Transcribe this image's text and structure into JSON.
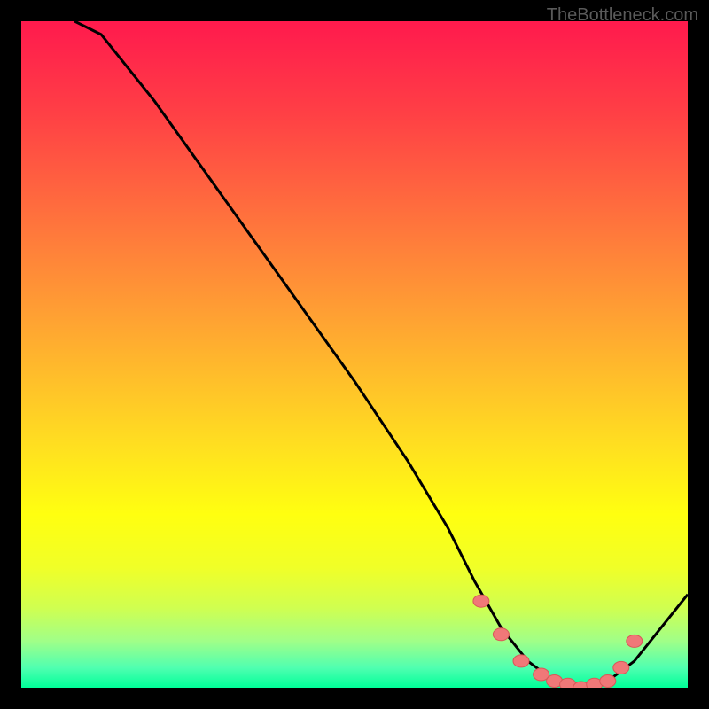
{
  "watermark": "TheBottleneck.com",
  "chart_data": {
    "type": "line",
    "title": "",
    "xlabel": "",
    "ylabel": "",
    "xlim": [
      0,
      100
    ],
    "ylim": [
      0,
      100
    ],
    "series": [
      {
        "name": "curve",
        "x": [
          8,
          12,
          20,
          30,
          40,
          50,
          58,
          64,
          68,
          72,
          76,
          80,
          84,
          88,
          92,
          100
        ],
        "values": [
          100,
          98,
          88,
          74,
          60,
          46,
          34,
          24,
          16,
          9,
          4,
          1,
          0,
          1,
          4,
          14
        ]
      }
    ],
    "markers": {
      "name": "highlighted-points",
      "x": [
        69,
        72,
        75,
        78,
        80,
        82,
        84,
        86,
        88,
        90,
        92
      ],
      "values": [
        13,
        8,
        4,
        2,
        1,
        0.5,
        0,
        0.5,
        1,
        3,
        7
      ]
    },
    "gradient_stops": [
      {
        "pos": 0,
        "color": "#ff1a4d"
      },
      {
        "pos": 50,
        "color": "#ffc02a"
      },
      {
        "pos": 80,
        "color": "#ffff10"
      },
      {
        "pos": 100,
        "color": "#00ff99"
      }
    ]
  }
}
